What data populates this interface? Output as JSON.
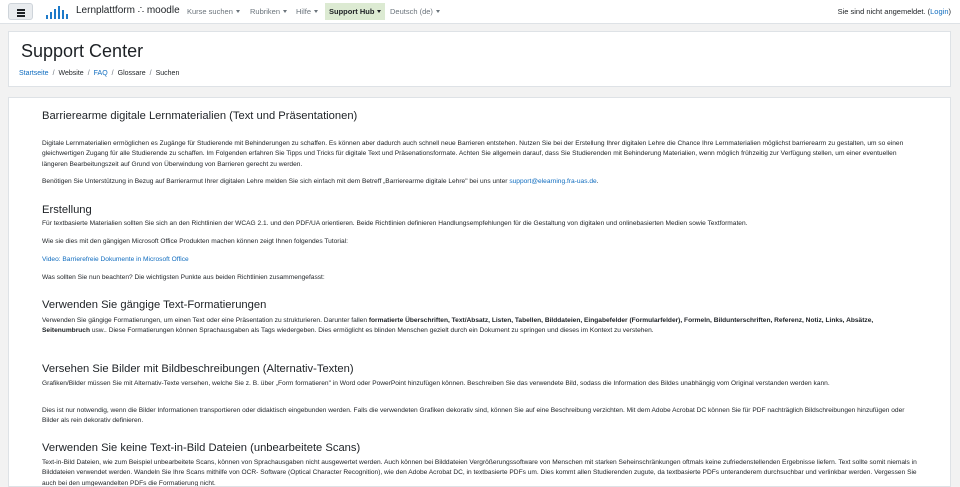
{
  "navbar": {
    "brand": "Lernplattform ∴ moodle",
    "items": [
      {
        "label": "Kurse suchen"
      },
      {
        "label": "Rubriken"
      },
      {
        "label": "Hilfe"
      },
      {
        "label": "Support Hub"
      },
      {
        "label": "Deutsch (de)"
      }
    ],
    "login_text": "Sie sind nicht angemeldet. (",
    "login_link": "Login",
    "login_close": ")"
  },
  "header": {
    "title": "Support Center",
    "breadcrumb": [
      "Startseite",
      "Website",
      "FAQ",
      "Glossare",
      "Suchen"
    ]
  },
  "article": {
    "title": "Barrierearme digitale Lernmaterialien (Text und Präsentationen)",
    "intro_p1": "Digitale Lernmaterialien ermöglichen es Zugänge für Studierende mit Behinderungen zu schaffen. Es können aber dadurch auch schnell neue Barrieren entstehen. Nutzen Sie bei der Erstellung Ihrer digitalen Lehre die Chance Ihre Lernmaterialien möglichst barrierearm zu gestalten, um so einen gleichwertigen Zugang für alle Studierende zu schaffen. Im Folgenden erfahren Sie Tipps und Tricks für digitale Text und Präsenationsformate. Achten Sie allgemein darauf, dass Sie Studierenden mit Behinderung Materialien, wenn möglich frühzeitig zur Verfügung stellen, um einer eventuellen längeren Bearbeitungszeit auf Grund von Überwindung von Barrieren gerecht zu werden.",
    "intro_p2": "Benötigen Sie Unterstützung in Bezug auf Barrierarmut Ihrer digitalen Lehre melden Sie sich einfach mit dem Betreff „Barrierearme digitale Lehre\" bei uns unter ",
    "intro_p2_link": "support@elearning.fra-uas.de",
    "intro_p2_end": ".",
    "s1_title": "Erstellung",
    "s1_p1": "Für textbasierte Materialien sollten Sie sich an den Richtlinien der WCAG 2.1. und den PDF/UA orientieren. Beide Richtlinien definieren Handlungsempfehlungen für die Gestaltung von digitalen und onlinebasierten  Medien sowie Textformaten.",
    "s1_p2": "Wie sie dies mit den gängigen Microsoft Office Produkten machen können zeigt Ihnen folgendes Tutorial:",
    "s1_link": "Video: Barrierefreie Dokumente in Microsoft Office",
    "s1_p3": "Was sollten Sie nun beachten? Die wichtigsten Punkte aus beiden Richtlinien zusammengefasst:",
    "s2_title": "Verwenden Sie gängige Text-Formatierungen",
    "s2_p1_a": "Verwenden Sie gängige Formatierungen, um einen Text oder eine Präsentation zu strukturieren. Darunter fallen ",
    "s2_p1_bold": "formatierte Überschriften, Text/Absatz, Listen, Tabellen, Bilddateien, Eingabefelder (Formularfelder), Formeln, Bildunterschriften, Referenz, Notiz, Links, Absätze, Seitenumbruch",
    "s2_p1_b": " usw.. Diese Formatierungen können Sprachausgaben als Tags wiedergeben. Dies ermöglicht es blinden Menschen gezielt durch ein Dokument zu springen und dieses im Kontext zu verstehen.",
    "s3_title": "Versehen Sie Bilder mit Bildbeschreibungen (Alternativ-Texten)",
    "s3_p1": "Grafiken/Bilder müssen Sie mit Alternativ-Texte versehen, welche Sie z. B. über „Form formatieren\" in Word oder PowerPoint hinzufügen können. Beschreiben Sie das verwendete Bild, sodass die Information des Bildes unabhängig vom Original verstanden werden kann.",
    "s3_p2": "Dies ist nur notwendig, wenn die Bilder Informationen transportieren oder didaktisch eingebunden werden. Falls die verwendeten Grafiken dekorativ sind, können Sie auf eine Beschreibung verzichten. Mit dem Adobe Acrobat DC können Sie für PDF nachträglich Bildschreibungen hinzufügen oder Bilder als rein dekorativ definieren.",
    "s4_title": "Verwenden Sie keine Text-in-Bild Dateien (unbearbeitete Scans)",
    "s4_p1": "Text-in-Bild Dateien, wie zum Beispiel unbearbeitete Scans, können von Sprachausgaben nicht ausgewertet werden. Auch können bei Bilddateien Vergrößerungssoftware von Menschen mit starken Seheinschränkungen oftmals keine zufriedenstellenden Ergebnisse liefern. Text sollte somit niemals in Bilddateien verwendet werden. Wandeln Sie Ihre Scans mithilfe von OCR- Software (Optical Character Recognition), wie den Adobe Acrobat DC, in textbasierte PDFs um. Dies kommt allen Studierenden zugute, da textbasierte PDFs unteranderem durchsuchbar und verlinkbar werden. Vergessen Sie auch bei den umgewandelten PDFs die Formatierung nicht."
  },
  "colors": {
    "link": "#0f6cbf",
    "active_nav_bg": "#dcead2",
    "brand_logo": "#1e7ac9"
  },
  "icons": {
    "menu": "hamburger-icon",
    "logo": "moodle-logo-icon",
    "dropdown": "caret-down-icon"
  }
}
